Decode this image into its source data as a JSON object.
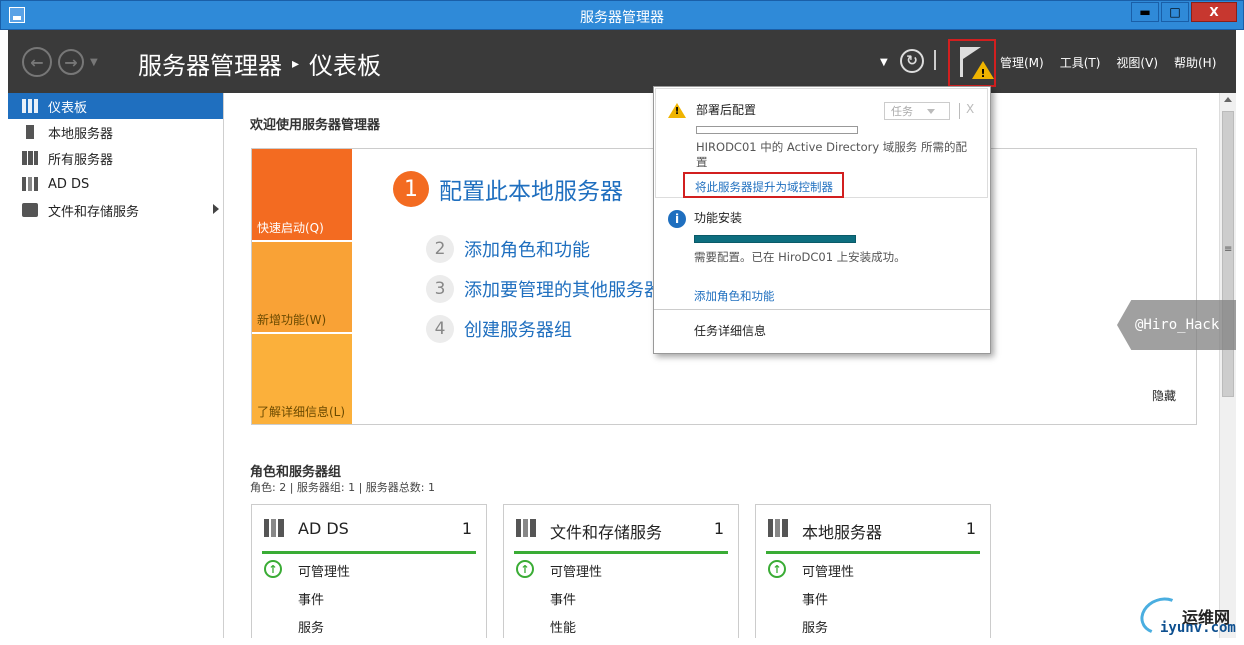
{
  "window": {
    "title": "服务器管理器",
    "minimize_label": "▬",
    "maximize_label": "□",
    "close_label": "X"
  },
  "header": {
    "breadcrumb_app": "服务器管理器",
    "breadcrumb_separator": "▸",
    "breadcrumb_page": "仪表板",
    "menus": [
      "管理(M)",
      "工具(T)",
      "视图(V)",
      "帮助(H)"
    ]
  },
  "sidebar": {
    "items": [
      {
        "label": "仪表板",
        "icon": "dashboard-icon",
        "active": true
      },
      {
        "label": "本地服务器",
        "icon": "server-icon"
      },
      {
        "label": "所有服务器",
        "icon": "servers-icon"
      },
      {
        "label": "AD DS",
        "icon": "adds-icon"
      },
      {
        "label": "文件和存储服务",
        "icon": "file-storage-icon",
        "expandable": true
      }
    ]
  },
  "welcome": {
    "title": "欢迎使用服务器管理器",
    "tiles": [
      "快速启动(Q)",
      "新增功能(W)",
      "了解详细信息(L)"
    ],
    "steps": [
      {
        "num": "1",
        "label": "配置此本地服务器"
      },
      {
        "num": "2",
        "label": "添加角色和功能"
      },
      {
        "num": "3",
        "label": "添加要管理的其他服务器"
      },
      {
        "num": "4",
        "label": "创建服务器组"
      }
    ],
    "hide_label": "隐藏"
  },
  "roles": {
    "title": "角色和服务器组",
    "summary": "角色: 2 | 服务器组: 1 | 服务器总数: 1",
    "cards": [
      {
        "name": "AD DS",
        "count": "1",
        "rows": [
          "可管理性",
          "事件",
          "服务"
        ]
      },
      {
        "name": "文件和存储服务",
        "count": "1",
        "rows": [
          "可管理性",
          "事件",
          "性能"
        ]
      },
      {
        "name": "本地服务器",
        "count": "1",
        "rows": [
          "可管理性",
          "事件",
          "服务"
        ]
      }
    ]
  },
  "notifications": {
    "deploy": {
      "title": "部署后配置",
      "task_label": "任务",
      "close_label": "X",
      "description": "HIRODC01 中的 Active Directory 域服务 所需的配置",
      "link": "将此服务器提升为域控制器"
    },
    "install": {
      "title": "功能安装",
      "description": "需要配置。已在 HiroDC01 上安装成功。",
      "link": "添加角色和功能",
      "progress": 1.0
    },
    "task_details": "任务详细信息"
  },
  "overlay": {
    "watermark": "@Hiro_Hack",
    "logo_name": "运维网",
    "logo_domain": "iyunv.com"
  },
  "colors": {
    "titlebar": "#2f8ad8",
    "header": "#3a3a3a",
    "accent": "#1f6fbf",
    "quick_start": "#f36b21",
    "tile_orange": "#f9a236",
    "ok_green": "#3aac35",
    "warning": "#f0b400",
    "highlight_red": "#d21f1f"
  }
}
